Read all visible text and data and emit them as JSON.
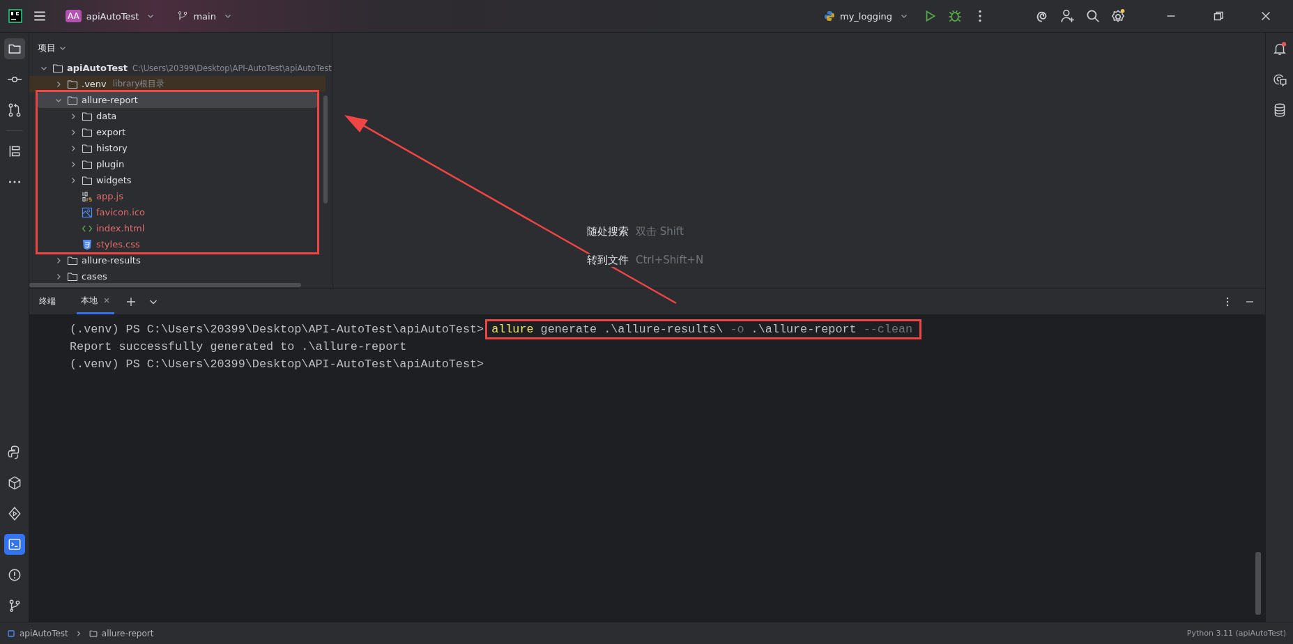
{
  "titlebar": {
    "project_badge": "AA",
    "project": "apiAutoTest",
    "branch": "main",
    "run_config": "my_logging"
  },
  "project_panel": {
    "title": "项目",
    "tree": [
      {
        "name": "apiAutoTest",
        "kind": "folder",
        "bold": true,
        "hint": "C:\\Users\\20399\\Desktop\\API-AutoTest\\apiAutoTest",
        "expanded": true,
        "children": [
          {
            "name": ".venv",
            "kind": "library",
            "hint": "library根目录",
            "expanded": false
          },
          {
            "name": "allure-report",
            "kind": "folder",
            "expanded": true,
            "selected": true,
            "framed": true,
            "children": [
              {
                "name": "data",
                "kind": "folder",
                "expanded": false
              },
              {
                "name": "export",
                "kind": "folder",
                "expanded": false
              },
              {
                "name": "history",
                "kind": "folder",
                "expanded": false
              },
              {
                "name": "plugin",
                "kind": "folder",
                "expanded": false
              },
              {
                "name": "widgets",
                "kind": "folder",
                "expanded": false
              },
              {
                "name": "app.js",
                "kind": "js",
                "untracked": true
              },
              {
                "name": "favicon.ico",
                "kind": "image",
                "untracked": true
              },
              {
                "name": "index.html",
                "kind": "html",
                "untracked": true
              },
              {
                "name": "styles.css",
                "kind": "css",
                "untracked": true
              }
            ]
          },
          {
            "name": "allure-results",
            "kind": "folder",
            "expanded": false
          },
          {
            "name": "cases",
            "kind": "folder",
            "expanded": false
          }
        ]
      }
    ]
  },
  "editor_hints": [
    {
      "action": "随处搜索",
      "shortcut": "双击 Shift"
    },
    {
      "action": "转到文件",
      "shortcut": "Ctrl+Shift+N"
    }
  ],
  "terminal": {
    "title": "终端",
    "tabs": [
      {
        "label": "本地",
        "selected": true
      }
    ],
    "lines": [
      {
        "prompt": "(.venv) PS C:\\Users\\20399\\Desktop\\API-AutoTest\\apiAutoTest>",
        "framed": true,
        "command": [
          {
            "text": "allure",
            "kind": "command"
          },
          {
            "text": "generate .\\allure-results\\",
            "kind": "arg"
          },
          {
            "text": "-o",
            "kind": "option"
          },
          {
            "text": ".\\allure-report",
            "kind": "arg"
          },
          {
            "text": "--clean",
            "kind": "option"
          }
        ]
      },
      {
        "output": "Report successfully generated to .\\allure-report"
      },
      {
        "prompt": "(.venv) PS C:\\Users\\20399\\Desktop\\API-AutoTest\\apiAutoTest>"
      }
    ]
  },
  "status_bar": {
    "breadcrumbs": [
      "apiAutoTest",
      "allure-report"
    ],
    "interpreter": "Python 3.11 (apiAutoTest)"
  }
}
